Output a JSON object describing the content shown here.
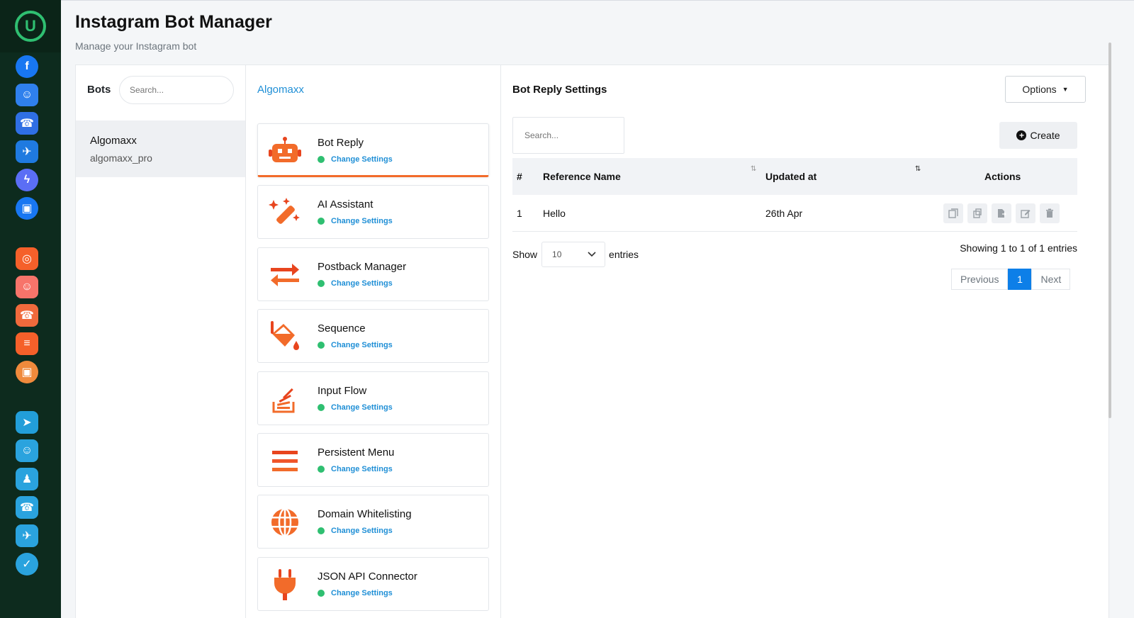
{
  "app": {
    "title": "Instagram Bot Manager",
    "subtitle": "Manage your Instagram bot"
  },
  "rail": {
    "logo_letter": "U",
    "icons": [
      {
        "name": "facebook-icon",
        "color": "#1877f2",
        "glyph": "f"
      },
      {
        "name": "robot-icon",
        "color": "#2f80ed",
        "glyph": "☺"
      },
      {
        "name": "phone-book-icon",
        "color": "#2f6fe4",
        "glyph": "☎"
      },
      {
        "name": "send-icon",
        "color": "#1f7ae0",
        "glyph": "✈"
      },
      {
        "name": "messenger-icon",
        "color": "#5b6ef5",
        "glyph": "ϟ"
      },
      {
        "name": "broadcast-icon",
        "color": "#1877f2",
        "glyph": "▣"
      },
      {
        "name": "instagram-icon",
        "color": "#f5602a",
        "glyph": "◎"
      },
      {
        "name": "ig-robot-icon",
        "color": "#f7746a",
        "glyph": "☺"
      },
      {
        "name": "ig-phone-book-icon",
        "color": "#f06a3c",
        "glyph": "☎"
      },
      {
        "name": "chat-icon",
        "color": "#f5602a",
        "glyph": "≡"
      },
      {
        "name": "ig-broadcast-icon",
        "color": "#f08a3c",
        "glyph": "▣"
      },
      {
        "name": "telegram-icon",
        "color": "#229ed9",
        "glyph": "➤"
      },
      {
        "name": "tg-robot-icon",
        "color": "#2aa3de",
        "glyph": "☺"
      },
      {
        "name": "group-icon",
        "color": "#2aa3de",
        "glyph": "♟"
      },
      {
        "name": "tg-phone-book-icon",
        "color": "#2aa3de",
        "glyph": "☎"
      },
      {
        "name": "tg-send-icon",
        "color": "#2aa3de",
        "glyph": "✈"
      },
      {
        "name": "check-icon",
        "color": "#2aa3de",
        "glyph": "✓"
      }
    ]
  },
  "bots": {
    "label": "Bots",
    "search_placeholder": "Search...",
    "selected": {
      "name": "Algomaxx",
      "handle": "algomaxx_pro"
    }
  },
  "menu": {
    "bot_title": "Algomaxx",
    "status_label": "Change Settings",
    "items": [
      {
        "title": "Bot Reply",
        "icon": "robot-icon"
      },
      {
        "title": "AI Assistant",
        "icon": "magic-wand-icon"
      },
      {
        "title": "Postback Manager",
        "icon": "arrows-exchange-icon"
      },
      {
        "title": "Sequence",
        "icon": "paint-bucket-icon"
      },
      {
        "title": "Input Flow",
        "icon": "stack-overflow-icon"
      },
      {
        "title": "Persistent Menu",
        "icon": "hamburger-menu-icon"
      },
      {
        "title": "Domain Whitelisting",
        "icon": "globe-icon"
      },
      {
        "title": "JSON API Connector",
        "icon": "plug-icon"
      }
    ]
  },
  "settings": {
    "title": "Bot Reply Settings",
    "options_label": "Options",
    "search_placeholder": "Search...",
    "create_label": "Create",
    "columns": [
      "#",
      "Reference Name",
      "Updated at",
      "Actions"
    ],
    "rows": [
      {
        "index": "1",
        "name": "Hello",
        "updated": "26th Apr"
      }
    ],
    "show_label": "Show",
    "page_size": "10",
    "entries_label": "entries",
    "info": "Showing 1 to 1 of 1 entries",
    "prev_label": "Previous",
    "current_page": "1",
    "next_label": "Next"
  },
  "colors": {
    "rail_bg": "#0d2b1e",
    "accent_blue": "#1f8fd6",
    "active_orange": "#f26b2a",
    "status_green": "#2fbf71",
    "page_active": "#0d7fe8"
  }
}
